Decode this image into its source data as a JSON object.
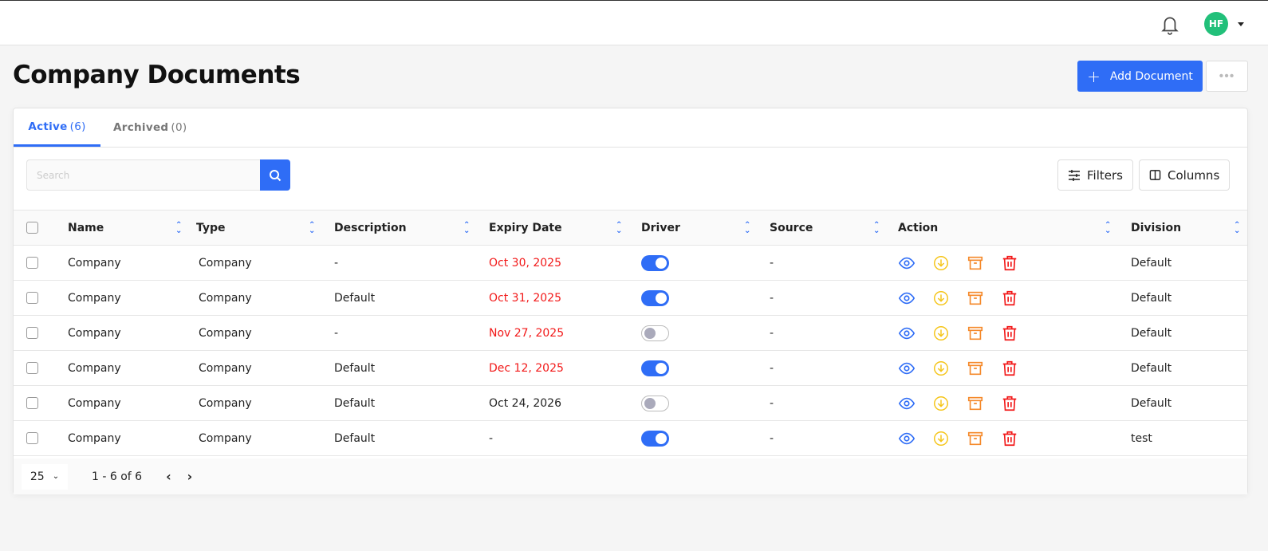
{
  "header": {
    "avatar_initials": "HF"
  },
  "page": {
    "title": "Company Documents",
    "add_label": "Add Document",
    "more_label": "•••"
  },
  "tabs": [
    {
      "label": "Active",
      "count": "(6)"
    },
    {
      "label": "Archived",
      "count": "(0)"
    }
  ],
  "search": {
    "placeholder": "Search"
  },
  "toolbar": {
    "filters": "Filters",
    "columns": "Columns"
  },
  "table": {
    "headers": [
      "Name",
      "Type",
      "Description",
      "Expiry Date",
      "Driver",
      "Source",
      "Action",
      "Division"
    ],
    "rows": [
      {
        "name": "Company",
        "type": "Company",
        "description": "-",
        "expiry": "Oct 30, 2025",
        "expired": true,
        "driver": true,
        "source": "-",
        "division": "Default"
      },
      {
        "name": "Company",
        "type": "Company",
        "description": "Default",
        "expiry": "Oct 31, 2025",
        "expired": true,
        "driver": true,
        "source": "-",
        "division": "Default"
      },
      {
        "name": "Company",
        "type": "Company",
        "description": "-",
        "expiry": "Nov 27, 2025",
        "expired": true,
        "driver": false,
        "source": "-",
        "division": "Default"
      },
      {
        "name": "Company",
        "type": "Company",
        "description": "Default",
        "expiry": "Dec 12, 2025",
        "expired": true,
        "driver": true,
        "source": "-",
        "division": "Default"
      },
      {
        "name": "Company",
        "type": "Company",
        "description": "Default",
        "expiry": "Oct 24, 2026",
        "expired": false,
        "driver": false,
        "source": "-",
        "division": "Default"
      },
      {
        "name": "Company",
        "type": "Company",
        "description": "Default",
        "expiry": "-",
        "expired": false,
        "driver": true,
        "source": "-",
        "division": "test"
      }
    ]
  },
  "pagination": {
    "per_page": "25",
    "range": "1 - 6 of 6",
    "prev": "‹",
    "next": "›"
  },
  "colors": {
    "accent": "#2f6df6",
    "expired": "#f21818",
    "view": "#2f6df6",
    "download": "#f5c518",
    "archive": "#f5892a",
    "delete": "#f21818"
  }
}
